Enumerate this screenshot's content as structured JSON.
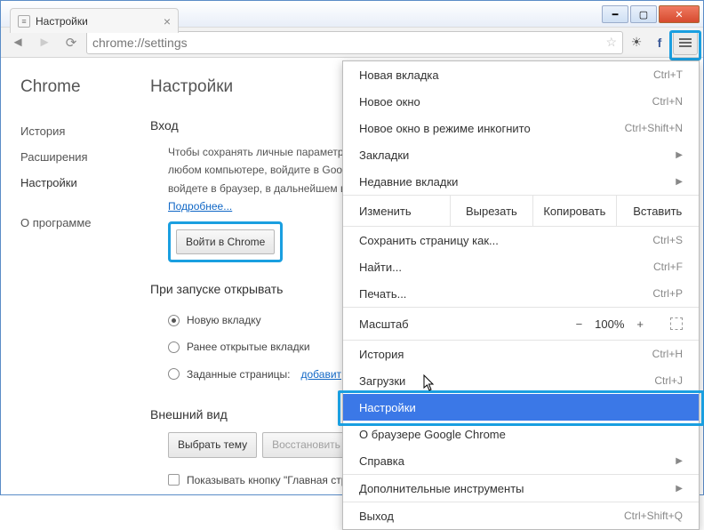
{
  "tab": {
    "title": "Настройки"
  },
  "url": "chrome://settings",
  "sidebar": {
    "brand": "Chrome",
    "items": [
      {
        "label": "История"
      },
      {
        "label": "Расширения"
      },
      {
        "label": "Настройки"
      }
    ],
    "about": "О программе"
  },
  "page": {
    "title": "Настройки",
    "login": {
      "heading": "Вход",
      "desc1": "Чтобы сохранять личные параметры",
      "desc2": "любом компьютере, войдите в Googl",
      "desc3": "войдете в браузер, в дальнейшем вхо",
      "more": "Подробнее...",
      "signin_btn": "Войти в Chrome"
    },
    "startup": {
      "heading": "При запуске открывать",
      "options": [
        "Новую вкладку",
        "Ранее открытые вкладки",
        "Заданные страницы:"
      ],
      "add_link": "добавит"
    },
    "appearance": {
      "heading": "Внешний вид",
      "choose_theme": "Выбрать тему",
      "restore": "Восстановить те",
      "show_home": "Показывать кнопку \"Главная стра"
    }
  },
  "menu": {
    "new_tab": "Новая вкладка",
    "new_tab_k": "Ctrl+T",
    "new_win": "Новое окно",
    "new_win_k": "Ctrl+N",
    "incognito": "Новое окно в режиме инкогнито",
    "incognito_k": "Ctrl+Shift+N",
    "bookmarks": "Закладки",
    "recent": "Недавние вкладки",
    "edit_label": "Изменить",
    "cut": "Вырезать",
    "copy": "Копировать",
    "paste": "Вставить",
    "save": "Сохранить страницу как...",
    "save_k": "Ctrl+S",
    "find": "Найти...",
    "find_k": "Ctrl+F",
    "print": "Печать...",
    "print_k": "Ctrl+P",
    "zoom": "Масштаб",
    "zoom_pct": "100%",
    "history": "История",
    "history_k": "Ctrl+H",
    "downloads": "Загрузки",
    "downloads_k": "Ctrl+J",
    "settings": "Настройки",
    "about": "О браузере Google Chrome",
    "help": "Справка",
    "tools": "Дополнительные инструменты",
    "exit": "Выход",
    "exit_k": "Ctrl+Shift+Q"
  }
}
